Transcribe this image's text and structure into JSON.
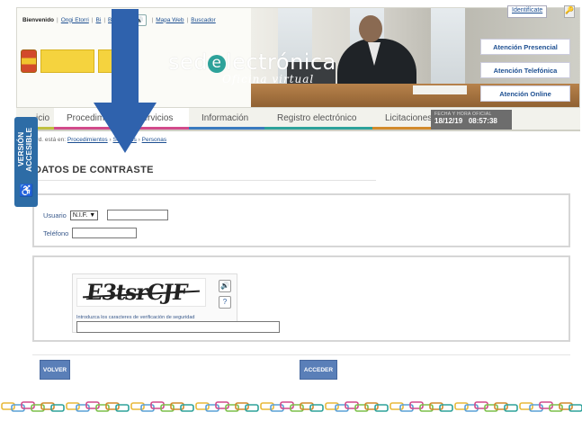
{
  "topbar": {
    "welcome": "Bienvenido",
    "user_link": "Ongi Etorri",
    "lang2": "Bi",
    "lang3": "Benvido",
    "map_link": "Mapa Web",
    "search_link": "Buscador"
  },
  "header": {
    "sede_prefix": "sed",
    "sede_e": "e",
    "sede_suffix": "lectrónica",
    "sede_subtitle": "Oficina virtual",
    "identify_link": "Identifícate"
  },
  "attention": {
    "presencial": "Atención Presencial",
    "telefonica": "Atención Telefónica",
    "online": "Atención Online"
  },
  "nav": {
    "tabs": [
      {
        "label": "icio"
      },
      {
        "label": "Procedimientos y servicios"
      },
      {
        "label": "Información"
      },
      {
        "label": "Registro electrónico"
      },
      {
        "label": "Licitaciones"
      }
    ],
    "date_label": "FECHA Y HORA OFICIAL",
    "date": "18/12/19",
    "time": "08:57:38"
  },
  "breadcrumb": {
    "prefix": "Ud. está en:",
    "item1": "Procedimientos",
    "item2": "Servicios",
    "item3": "Personas"
  },
  "accessible": {
    "label": "VERSIÓN ACCESIBLE"
  },
  "page": {
    "title": "DATOS DE CONTRASTE"
  },
  "form": {
    "usuario_label": "Usuario",
    "doc_type": "N.I.F.",
    "telefono_label": "Teléfono",
    "captcha_text": "E3tsrCJF",
    "captcha_hint": "Introduzca los caracteres de verificación de seguridad",
    "volver_label": "VOLVER",
    "acceder_label": "ACCEDER"
  },
  "colors": {
    "accent_blue": "#5a7fb8",
    "nav_pink": "#d24a8b",
    "arrow": "#2f62ad"
  }
}
